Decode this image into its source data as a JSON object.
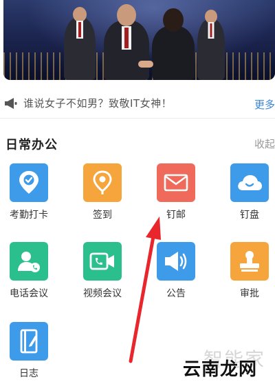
{
  "notice": {
    "text": "谁说女子不如男？致敬IT女神！",
    "more_label": "更多"
  },
  "section": {
    "title": "日常办公",
    "collapse_label": "收起"
  },
  "apps": [
    {
      "label": "考勤打卡",
      "icon": "location-check-icon",
      "color": "#3d9be9"
    },
    {
      "label": "签到",
      "icon": "location-pin-icon",
      "color": "#f5a53b"
    },
    {
      "label": "钉邮",
      "icon": "mail-icon",
      "color": "#ef6a5a"
    },
    {
      "label": "钉盘",
      "icon": "cloud-icon",
      "color": "#3d9be9"
    },
    {
      "label": "电话会议",
      "icon": "phone-contact-icon",
      "color": "#2bbf8e"
    },
    {
      "label": "视频会议",
      "icon": "video-call-icon",
      "color": "#2bbf8e"
    },
    {
      "label": "公告",
      "icon": "megaphone-icon",
      "color": "#3d9be9"
    },
    {
      "label": "审批",
      "icon": "stamp-icon",
      "color": "#f5a53b"
    },
    {
      "label": "日志",
      "icon": "notebook-icon",
      "color": "#3d9be9"
    }
  ],
  "watermark": {
    "light_text": "智能家",
    "dark_text": "云南龙网"
  },
  "colors": {
    "link": "#3a86d6",
    "arrow": "#e8262b"
  }
}
